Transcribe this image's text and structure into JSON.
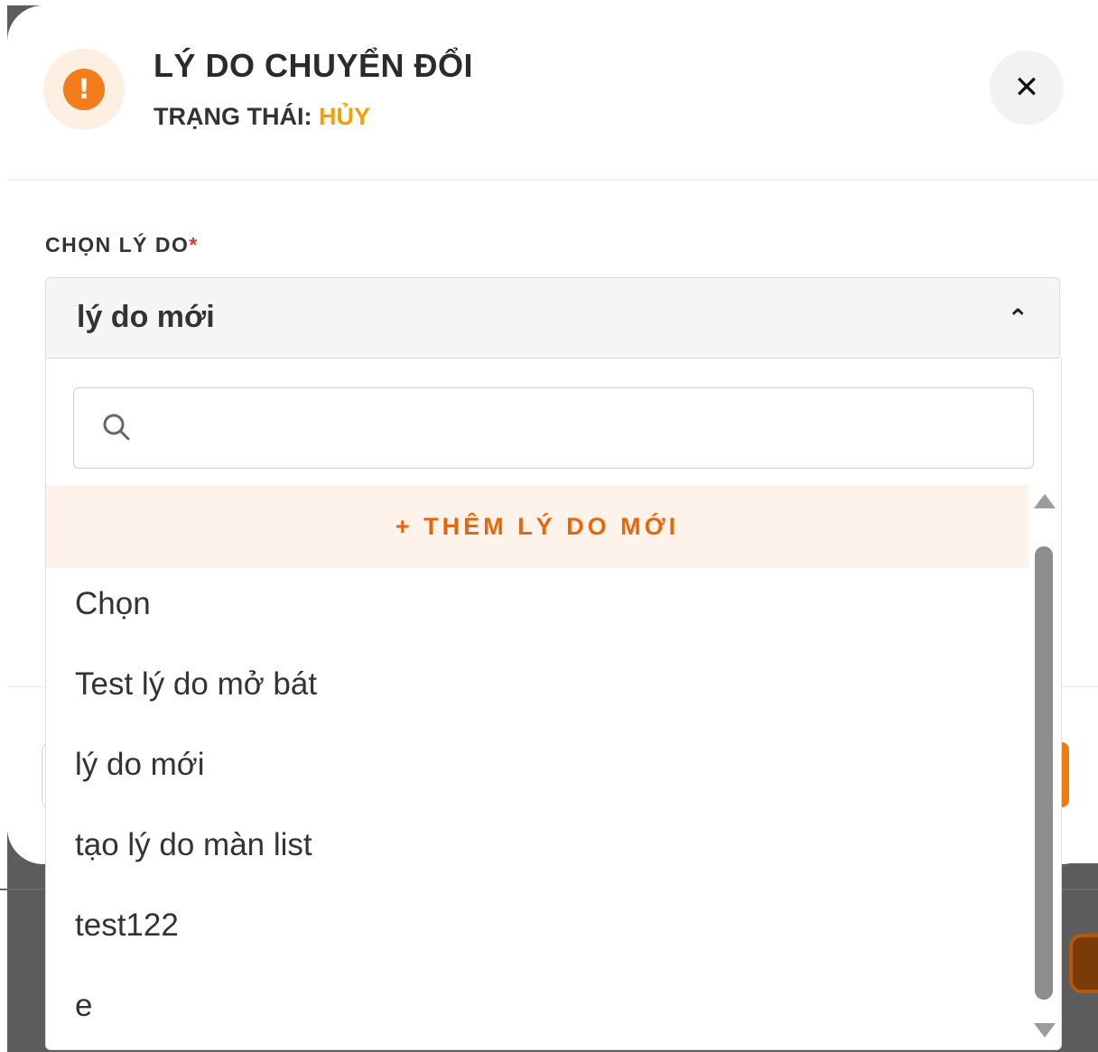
{
  "modal": {
    "title": "LÝ DO CHUYỂN ĐỔI",
    "status_label": "TRẠNG THÁI: ",
    "status_value": "HỦY",
    "alert_icon": "exclamation-icon",
    "close_icon": "close-icon",
    "close_symbol": "✕",
    "alert_symbol": "!"
  },
  "field": {
    "label": "CHỌN LÝ DO",
    "required_mark": "*",
    "selected_value": "lý do mới",
    "chevron_symbol": "⌃"
  },
  "dropdown": {
    "search_placeholder": "",
    "add_new_label": "+ THÊM LÝ DO MỚI",
    "options": [
      "Chọn",
      "Test lý do mở bát",
      "lý do mới",
      "tạo lý do màn list",
      "test122",
      "e"
    ]
  },
  "colors": {
    "accent": "#f57c1a",
    "status": "#f5a000",
    "add_new_text": "#e8650c",
    "add_new_bg": "#fdf3ea",
    "required": "#e53935"
  }
}
